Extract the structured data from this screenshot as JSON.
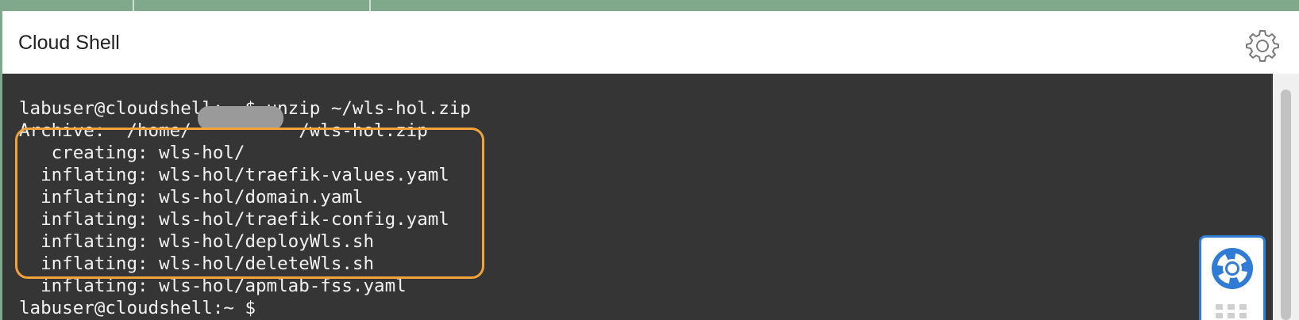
{
  "panel": {
    "title": "Cloud Shell",
    "settings_icon": "gear-icon"
  },
  "terminal": {
    "lines": [
      "labuser@cloudshell:~ $ unzip ~/wls-hol.zip",
      "Archive:  /home/          /wls-hol.zip",
      "   creating: wls-hol/",
      "  inflating: wls-hol/traefik-values.yaml",
      "  inflating: wls-hol/domain.yaml",
      "  inflating: wls-hol/traefik-config.yaml",
      "  inflating: wls-hol/deployWls.sh",
      "  inflating: wls-hol/deleteWls.sh",
      "  inflating: wls-hol/apmlab-fss.yaml",
      "labuser@cloudshell:~ $ "
    ],
    "background": "#353535",
    "text_color": "#f2f2f2",
    "highlight_color": "#f2a33a"
  },
  "help_widget": {
    "icon": "lifebuoy-icon",
    "accent": "#2f7bd6"
  }
}
